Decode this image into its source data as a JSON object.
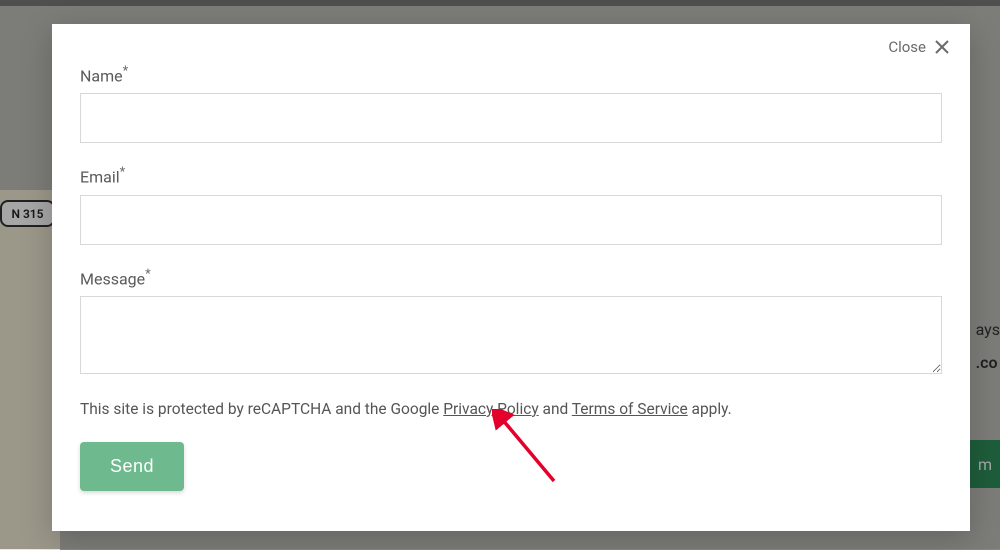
{
  "modal": {
    "close_label": "Close",
    "name_label": "Name",
    "email_label": "Email",
    "message_label": "Message",
    "required_mark": "*",
    "legal_prefix": "This site is protected by reCAPTCHA and the Google ",
    "privacy_label": "Privacy Policy",
    "legal_mid": " and ",
    "terms_label": "Terms of Service",
    "legal_suffix": " apply.",
    "send_label": "Send"
  },
  "background": {
    "road_sign": "N 315",
    "right_text_1": "ays",
    "right_text_2": ".co",
    "right_chip_text": "m"
  },
  "colors": {
    "accent": "#6fb98f",
    "arrow": "#e3002b"
  }
}
